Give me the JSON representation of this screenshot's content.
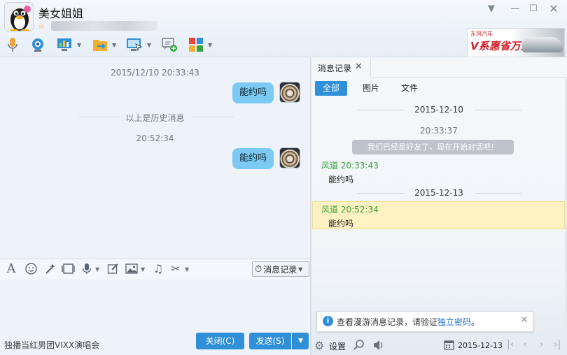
{
  "header": {
    "contact_name": "美女姐姐",
    "ad": {
      "brand": "东风汽车",
      "slogan": "V系惠省万元"
    }
  },
  "chat": {
    "messages": [
      {
        "time": "2015/12/10 20:33:43",
        "text": "能约吗"
      },
      {
        "time": "20:52:34",
        "text": "能约吗"
      }
    ],
    "history_divider": "以上是历史消息"
  },
  "input_toolbar": {
    "history_label": "消息记录"
  },
  "footer": {
    "marquee": "独播当红男团VIXX演唱会",
    "close_label": "关闭(C)",
    "send_label": "发送(S)"
  },
  "history_panel": {
    "tab_label": "消息记录",
    "filters": [
      "全部",
      "图片",
      "文件"
    ],
    "groups": [
      {
        "date": "2015-12-10",
        "time": "20:33:37",
        "system": "我们已经是好友了，现在开始对话吧！",
        "sender": "风道 20:33:43",
        "text": "能约吗"
      },
      {
        "date": "2015-12-13",
        "sender": "风道 20:52:34",
        "text": "能约吗"
      }
    ],
    "notice": {
      "text": "查看漫游消息记录，请验证",
      "link": "独立密码",
      "end": "。"
    },
    "settings_label": "设置",
    "date": "2015-12-13"
  }
}
